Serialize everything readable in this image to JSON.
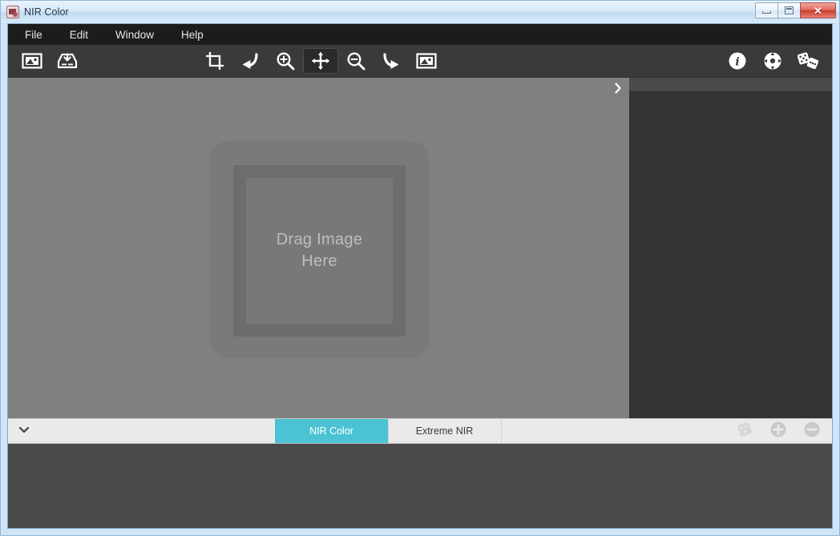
{
  "window": {
    "title": "NIR Color",
    "icon": "app-image-icon",
    "controls": {
      "minimize": "Minimize",
      "maximize": "Maximize",
      "close": "Close"
    }
  },
  "menubar": {
    "items": [
      {
        "label": "File",
        "name": "menu-file"
      },
      {
        "label": "Edit",
        "name": "menu-edit"
      },
      {
        "label": "Window",
        "name": "menu-window"
      },
      {
        "label": "Help",
        "name": "menu-help"
      }
    ]
  },
  "toolbar": {
    "left_group": [
      {
        "icon": "open-image-icon",
        "tooltip": "Open Image"
      },
      {
        "icon": "save-image-icon",
        "tooltip": "Save Image"
      }
    ],
    "center_group": [
      {
        "icon": "crop-icon",
        "tooltip": "Crop",
        "active": false
      },
      {
        "icon": "undo-icon",
        "tooltip": "Undo",
        "active": false
      },
      {
        "icon": "zoom-in-icon",
        "tooltip": "Zoom In",
        "active": false
      },
      {
        "icon": "move-icon",
        "tooltip": "Pan",
        "active": true
      },
      {
        "icon": "zoom-out-icon",
        "tooltip": "Zoom Out",
        "active": false
      },
      {
        "icon": "redo-icon",
        "tooltip": "Redo",
        "active": false
      },
      {
        "icon": "fit-image-icon",
        "tooltip": "Fit Image",
        "active": false
      }
    ],
    "right_group": [
      {
        "icon": "info-icon",
        "tooltip": "Info"
      },
      {
        "icon": "settings-icon",
        "tooltip": "Settings"
      },
      {
        "icon": "dice-pair-icon",
        "tooltip": "Randomize"
      }
    ]
  },
  "canvas": {
    "drop_label_line1": "Drag Image",
    "drop_label_line2": "Here",
    "expand_icon": "chevron-right-icon",
    "background_color": "#808080"
  },
  "side_panel": {
    "background_color": "#333333",
    "header_color": "#4a4a4a"
  },
  "tabbar": {
    "collapse_icon": "chevron-down-icon",
    "tabs": [
      {
        "label": "NIR Color",
        "active": true
      },
      {
        "label": "Extreme NIR",
        "active": false
      }
    ],
    "actions": [
      {
        "icon": "dice-icon",
        "tooltip": "Randomize Preset"
      },
      {
        "icon": "plus-icon",
        "tooltip": "Add Preset"
      },
      {
        "icon": "minus-icon",
        "tooltip": "Remove Preset"
      }
    ],
    "active_color": "#4cc3d3"
  }
}
